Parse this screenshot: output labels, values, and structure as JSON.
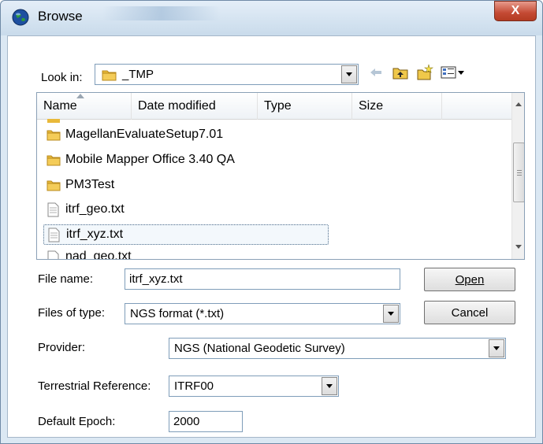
{
  "window": {
    "title": "Browse",
    "close_label": "X"
  },
  "look_in": {
    "label": "Look in:",
    "value": "_TMP",
    "toolbar_icons": [
      "back-arrow-icon",
      "up-folder-icon",
      "new-folder-icon",
      "view-menu-icon"
    ]
  },
  "file_list": {
    "columns": [
      "Name",
      "Date modified",
      "Type",
      "Size"
    ],
    "items": [
      {
        "name": "MagellanEvaluateSetup7.01",
        "kind": "folder"
      },
      {
        "name": "Mobile Mapper Office 3.40 QA",
        "kind": "folder"
      },
      {
        "name": "PM3Test",
        "kind": "folder"
      },
      {
        "name": "itrf_geo.txt",
        "kind": "file"
      },
      {
        "name": "itrf_xyz.txt",
        "kind": "file",
        "selected": true
      },
      {
        "name": "nad_geo.txt",
        "kind": "file"
      }
    ]
  },
  "file_name": {
    "label": "File name:",
    "value": "itrf_xyz.txt"
  },
  "files_of_type": {
    "label": "Files of type:",
    "value": "NGS format (*.txt)"
  },
  "buttons": {
    "open": "Open",
    "cancel": "Cancel"
  },
  "provider": {
    "label": "Provider:",
    "value": "NGS (National Geodetic Survey)"
  },
  "terrestrial_reference": {
    "label": "Terrestrial Reference:",
    "value": "ITRF00"
  },
  "default_epoch": {
    "label": "Default Epoch:",
    "value": "2000"
  },
  "colors": {
    "folder": "#e9b93a",
    "close_button": "#c44a34",
    "selection_outline": "#4a6a8a"
  }
}
